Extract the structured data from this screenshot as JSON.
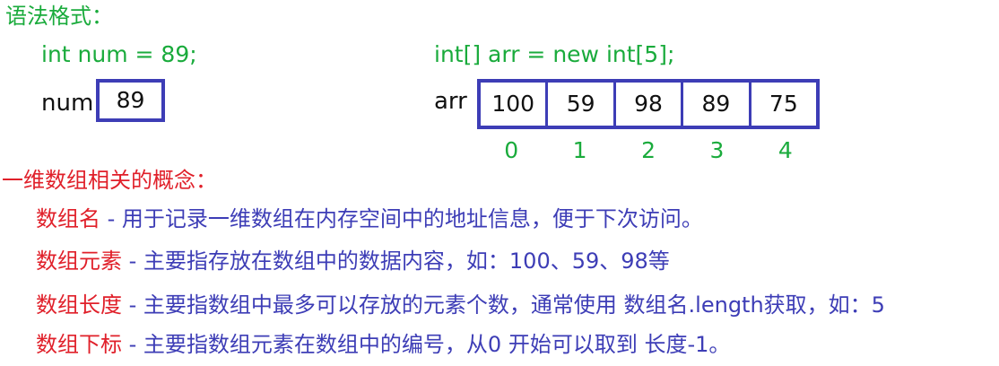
{
  "syntax_heading": "语法格式：",
  "code_scalar": "int num = 89;",
  "code_array": "int[] arr = new int[5];",
  "scalar": {
    "label": "num",
    "value": "89"
  },
  "array": {
    "label": "arr",
    "values": [
      "100",
      "59",
      "98",
      "89",
      "75"
    ],
    "indices": [
      "0",
      "1",
      "2",
      "3",
      "4"
    ]
  },
  "concepts_heading": "一维数组相关的概念：",
  "concepts": [
    {
      "term": "数组名",
      "desc": " - 用于记录一维数组在内存空间中的地址信息，便于下次访问。"
    },
    {
      "term": "数组元素",
      "desc": " - 主要指存放在数组中的数据内容，如：100、59、98等"
    },
    {
      "term": "数组长度",
      "desc": " - 主要指数组中最多可以存放的元素个数，通常使用 数组名.length获取，如：5"
    },
    {
      "term": "数组下标",
      "desc": " - 主要指数组元素在数组中的编号，从0 开始可以取到 长度-1。"
    }
  ],
  "colors": {
    "green": "#1aab3c",
    "red": "#e0202a",
    "blue": "#3d3db6",
    "text": "#111111"
  }
}
